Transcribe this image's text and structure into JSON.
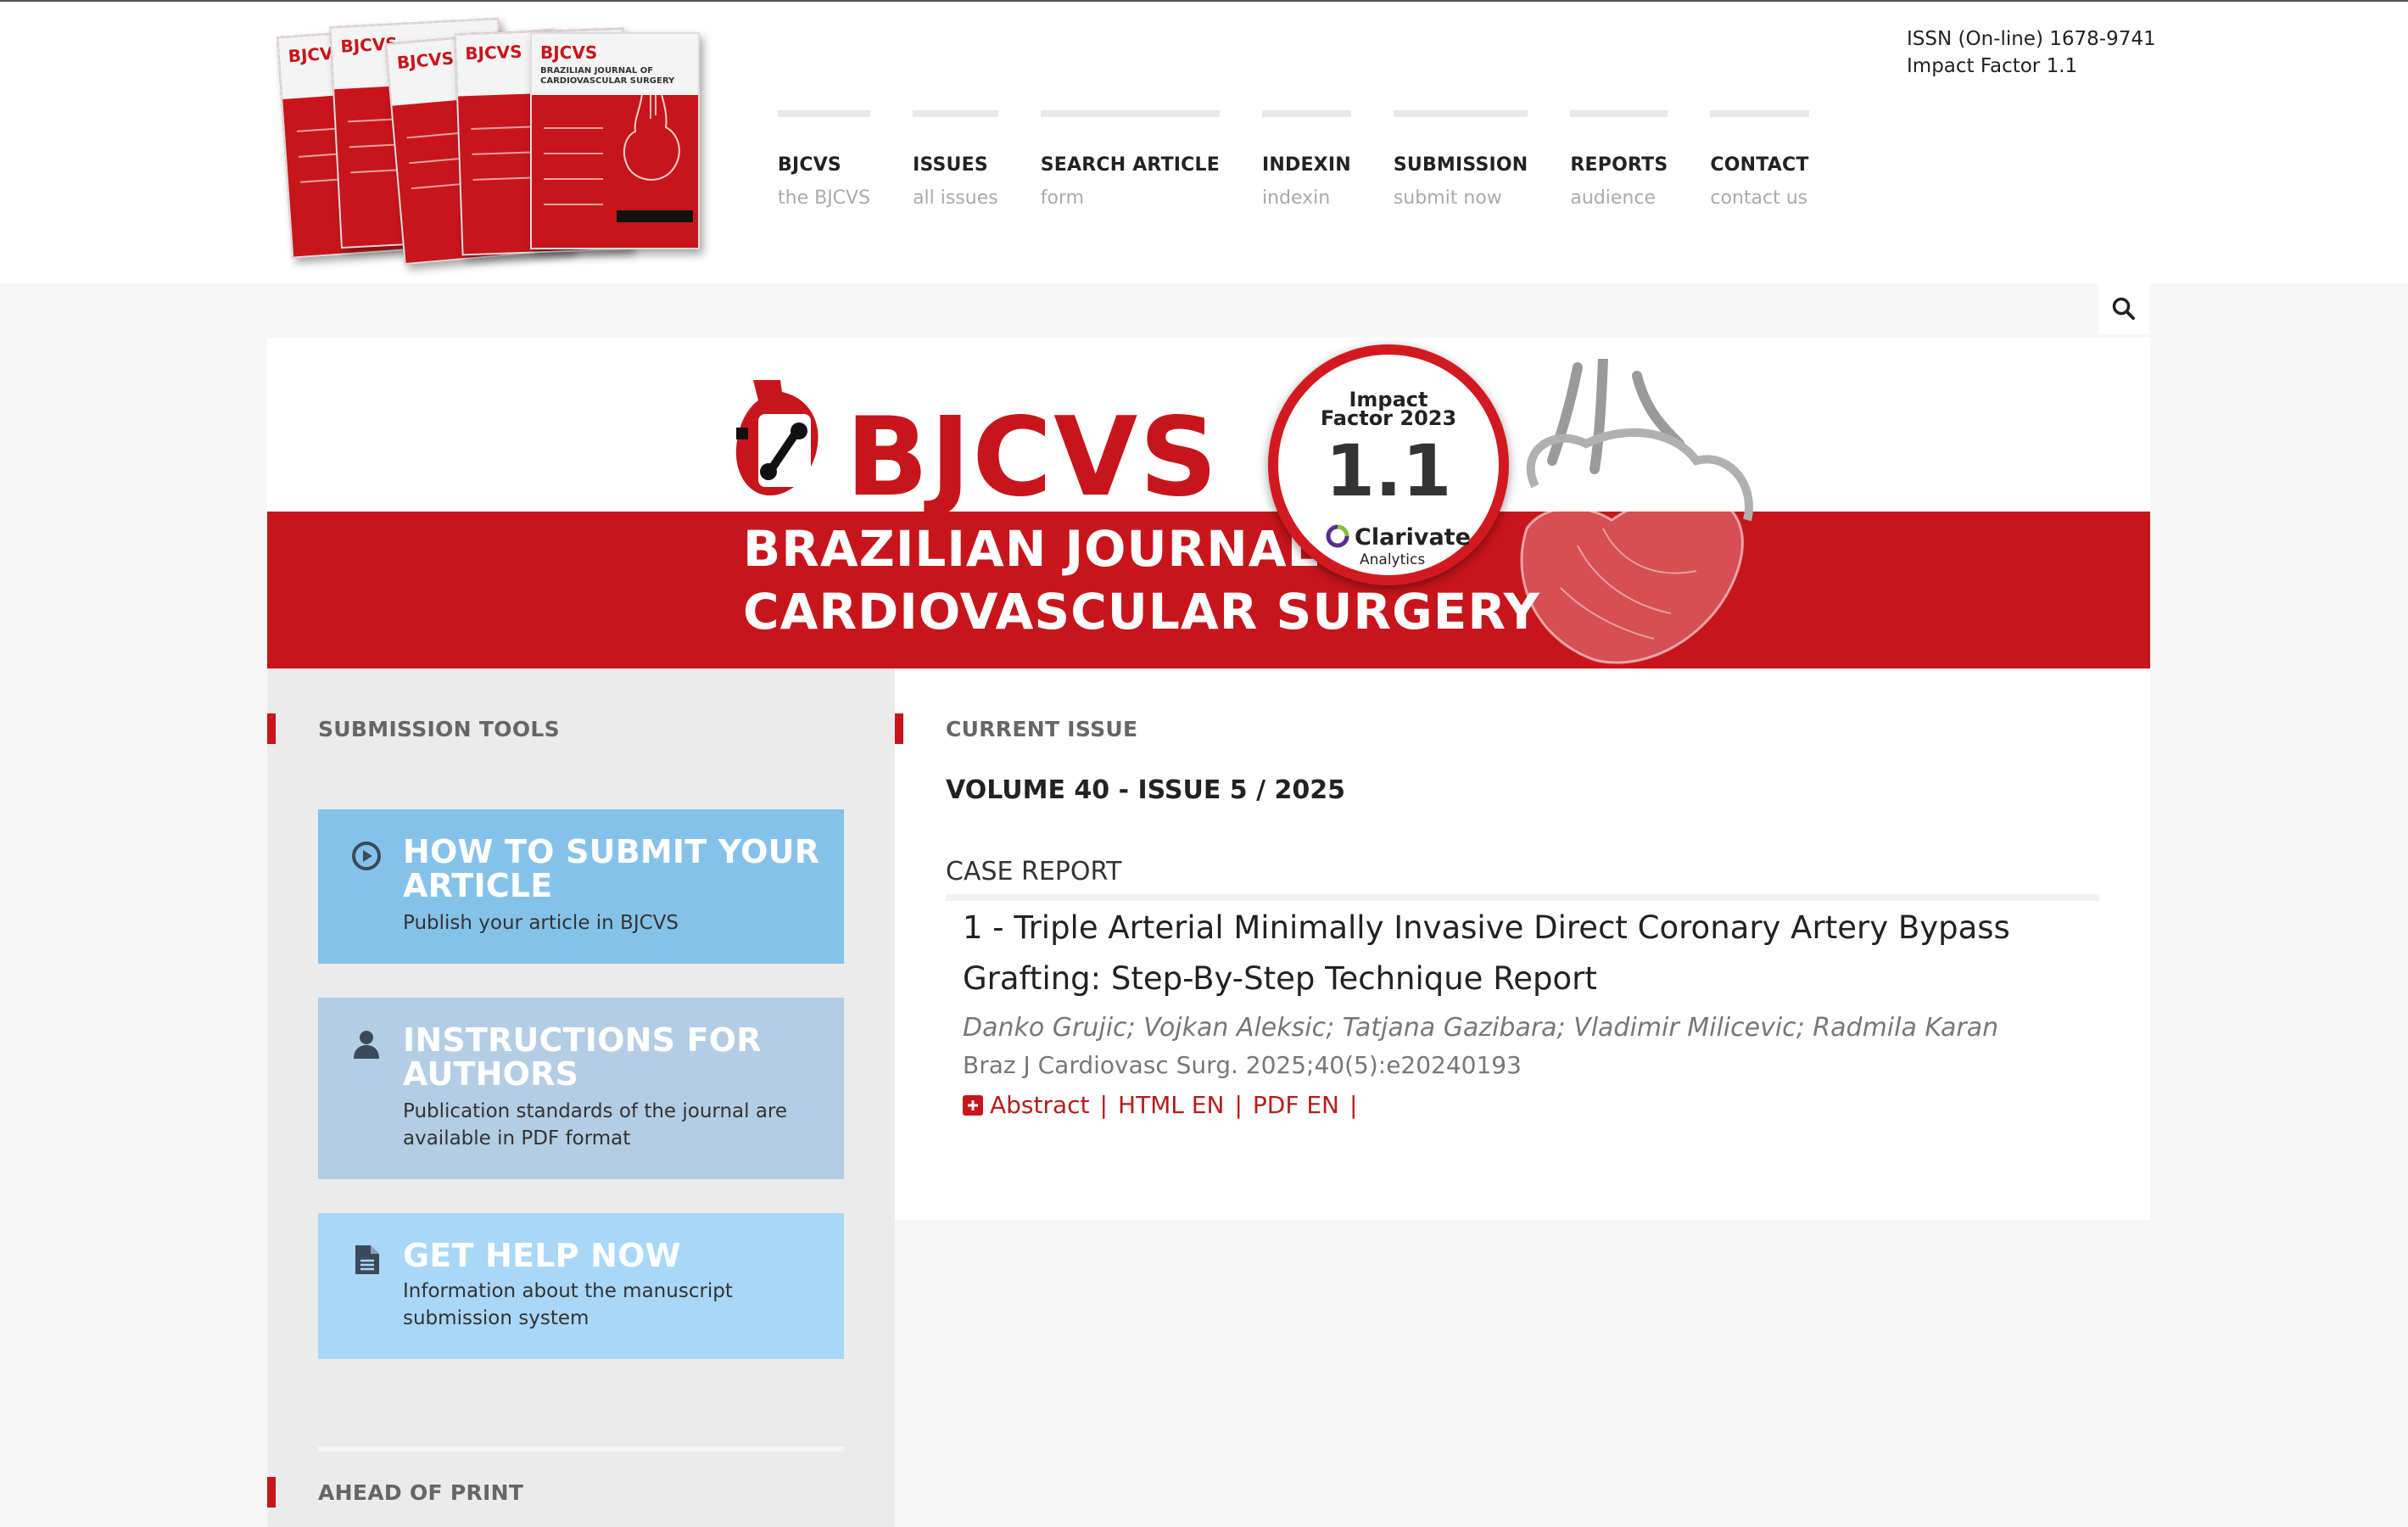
{
  "header": {
    "issn": "ISSN (On-line) 1678-9741",
    "impact_factor": "Impact Factor 1.1",
    "cover_brand": "BJCVS",
    "cover_subtitle_line1": "BRAZILIAN JOURNAL OF",
    "cover_subtitle_line2": "CARDIOVASCULAR SURGERY"
  },
  "nav": [
    {
      "label": "BJCVS",
      "sub": "the BJCVS"
    },
    {
      "label": "ISSUES",
      "sub": "all issues"
    },
    {
      "label": "SEARCH ARTICLE",
      "sub": "form"
    },
    {
      "label": "INDEXIN",
      "sub": "indexin"
    },
    {
      "label": "SUBMISSION",
      "sub": "submit now"
    },
    {
      "label": "REPORTS",
      "sub": "audience"
    },
    {
      "label": "CONTACT",
      "sub": "contact us"
    }
  ],
  "banner": {
    "brand": "BJCVS",
    "subtitle_line1": "BRAZILIAN JOURNAL OF",
    "subtitle_line2": "CARDIOVASCULAR SURGERY",
    "badge_line1": "Impact",
    "badge_line2": "Factor 2023",
    "badge_value": "1.1",
    "badge_org": "Clarivate",
    "badge_org_sub": "Analytics"
  },
  "sidebar": {
    "title": "SUBMISSION TOOLS",
    "tools": [
      {
        "title": "HOW TO SUBMIT YOUR ARTICLE",
        "desc": "Publish your article in BJCVS",
        "icon": "play-circle-icon"
      },
      {
        "title": "INSTRUCTIONS FOR AUTHORS",
        "desc": "Publication standards of the journal are available in PDF format",
        "icon": "user-icon"
      },
      {
        "title": "GET HELP NOW",
        "desc": "Information about the manuscript submission system",
        "icon": "document-icon"
      }
    ],
    "ahead_title": "AHEAD OF PRINT"
  },
  "content": {
    "section_title": "CURRENT ISSUE",
    "issue": "VOLUME 40 - ISSUE 5 / 2025",
    "category": "CASE REPORT",
    "article": {
      "title": "1 - Triple Arterial Minimally Invasive Direct Coronary Artery Bypass Grafting: Step-By-Step Technique Report",
      "authors": "Danko Grujic; Vojkan Aleksic; Tatjana Gazibara; Vladimir Milicevic; Radmila Karan",
      "citation": "Braz J Cardiovasc Surg. 2025;40(5):e20240193",
      "links": {
        "abstract": "Abstract",
        "html": "HTML EN",
        "pdf": "PDF EN",
        "sep": "|"
      }
    }
  },
  "colors": {
    "brand_red": "#c8151b",
    "card1": "#85c2ea",
    "card2": "#b3cde4",
    "card3": "#a8d7f7"
  }
}
